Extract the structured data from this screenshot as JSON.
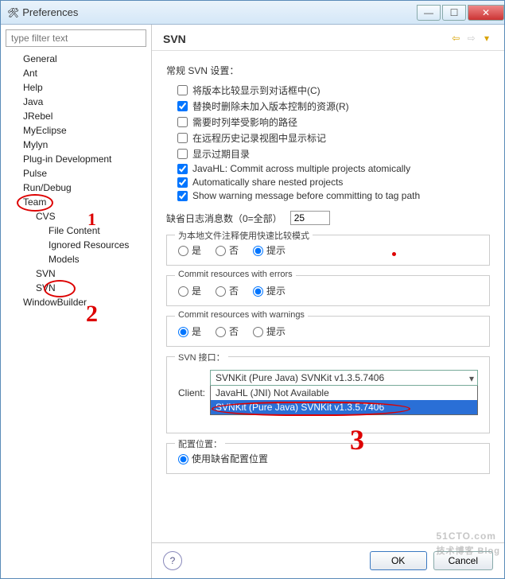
{
  "window": {
    "title": "Preferences"
  },
  "sidebar": {
    "filter_placeholder": "type filter text",
    "items": [
      {
        "label": "General",
        "level": 1
      },
      {
        "label": "Ant",
        "level": 1
      },
      {
        "label": "Help",
        "level": 1
      },
      {
        "label": "Java",
        "level": 1
      },
      {
        "label": "JRebel",
        "level": 1
      },
      {
        "label": "MyEclipse",
        "level": 1
      },
      {
        "label": "Mylyn",
        "level": 1
      },
      {
        "label": "Plug-in Development",
        "level": 1
      },
      {
        "label": "Pulse",
        "level": 1
      },
      {
        "label": "Run/Debug",
        "level": 1
      },
      {
        "label": "Team",
        "level": 1,
        "circled": true
      },
      {
        "label": "CVS",
        "level": 2
      },
      {
        "label": "File Content",
        "level": 3
      },
      {
        "label": "Ignored Resources",
        "level": 3
      },
      {
        "label": "Models",
        "level": 3
      },
      {
        "label": "SVN",
        "level": 2
      },
      {
        "label": "SVN",
        "level": 2,
        "circled": true,
        "small": true
      },
      {
        "label": "WindowBuilder",
        "level": 1
      }
    ]
  },
  "header": {
    "title": "SVN"
  },
  "content": {
    "section_general": "常规 SVN 设置：",
    "checks": [
      {
        "label": "将版本比较显示到对话框中(C)",
        "checked": false
      },
      {
        "label": "替换时删除未加入版本控制的资源(R)",
        "checked": true
      },
      {
        "label": "需要时列举受影响的路径",
        "checked": false
      },
      {
        "label": "在远程历史记录视图中显示标记",
        "checked": false
      },
      {
        "label": "显示过期目录",
        "checked": false
      },
      {
        "label": "JavaHL: Commit across multiple projects atomically",
        "checked": true
      },
      {
        "label": "Automatically share nested projects",
        "checked": true
      },
      {
        "label": "Show warning message before committing to tag path",
        "checked": true
      }
    ],
    "logcount_label": "缺省日志消息数（0=全部）",
    "logcount_value": "25",
    "group_compare": {
      "legend": "为本地文件注释使用快速比较模式",
      "opts": [
        "是",
        "否",
        "提示"
      ],
      "selected": "提示"
    },
    "group_errors": {
      "legend": "Commit resources with errors",
      "opts": [
        "是",
        "否",
        "提示"
      ],
      "selected": "提示"
    },
    "group_warnings": {
      "legend": "Commit resources with warnings",
      "opts": [
        "是",
        "否",
        "提示"
      ],
      "selected": "是"
    },
    "interface_group": {
      "legend": "SVN 接口：",
      "client_label": "Client:",
      "selected": "SVNKit (Pure Java) SVNKit v1.3.5.7406",
      "options": [
        "JavaHL (JNI) Not Available",
        "SVNKit (Pure Java) SVNKit v1.3.5.7406"
      ]
    },
    "config_group": {
      "legend": "配置位置：",
      "opt": "使用缺省配置位置"
    }
  },
  "buttons": {
    "ok": "OK",
    "cancel": "Cancel"
  },
  "watermark": {
    "main": "51CTO.com",
    "sub": "技术博客 Blog"
  }
}
